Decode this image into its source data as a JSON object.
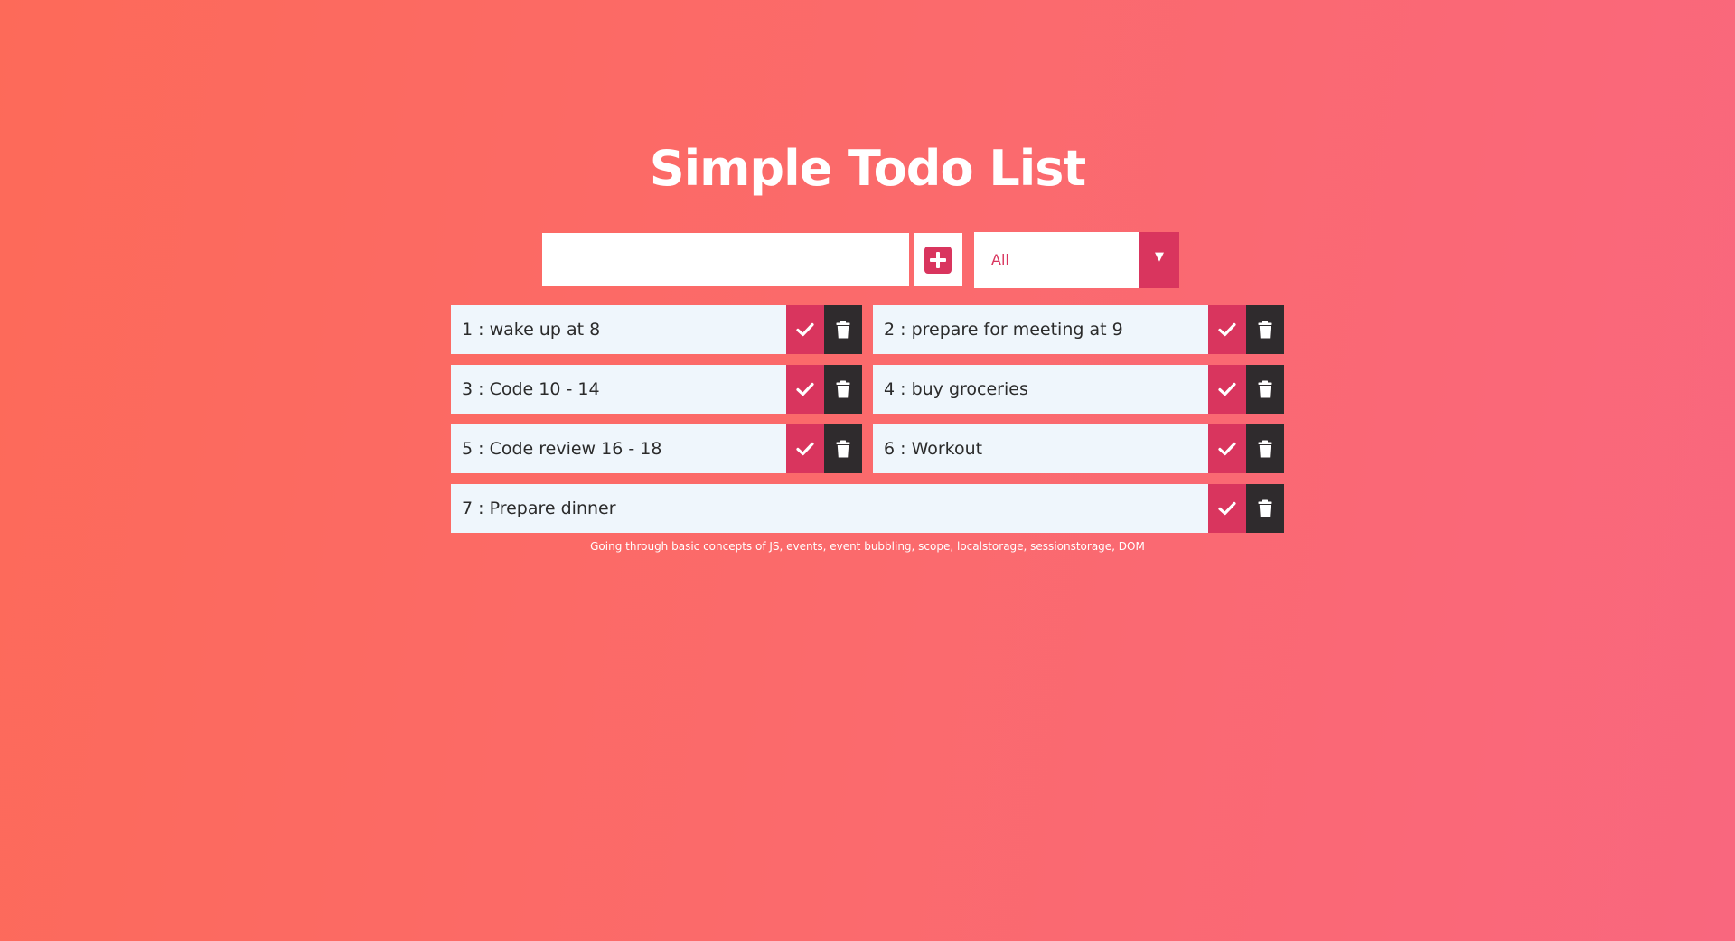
{
  "app": {
    "title": "Simple Todo List"
  },
  "form": {
    "input_value": "",
    "input_placeholder": "",
    "add_icon": "plus-square-icon",
    "filter": {
      "selected": "All",
      "options": [
        "All"
      ],
      "arrow": "▼"
    }
  },
  "todos": [
    {
      "text": "1 : wake up at 8"
    },
    {
      "text": "2 : prepare for meeting at 9"
    },
    {
      "text": "3 : Code 10 - 14"
    },
    {
      "text": "4 : buy groceries"
    },
    {
      "text": "5 : Code review 16 - 18"
    },
    {
      "text": "6 : Workout"
    },
    {
      "text": "7 : Prepare dinner"
    }
  ],
  "footer": {
    "note": "Going through basic concepts of JS, events, event bubbling, scope, localstorage, sessionstorage, DOM"
  },
  "colors": {
    "background_start": "#fd6a59",
    "background_end": "#f9677e",
    "accent": "#d9355e",
    "dark": "#2f2b2d",
    "item_bg": "#eff6fc"
  }
}
